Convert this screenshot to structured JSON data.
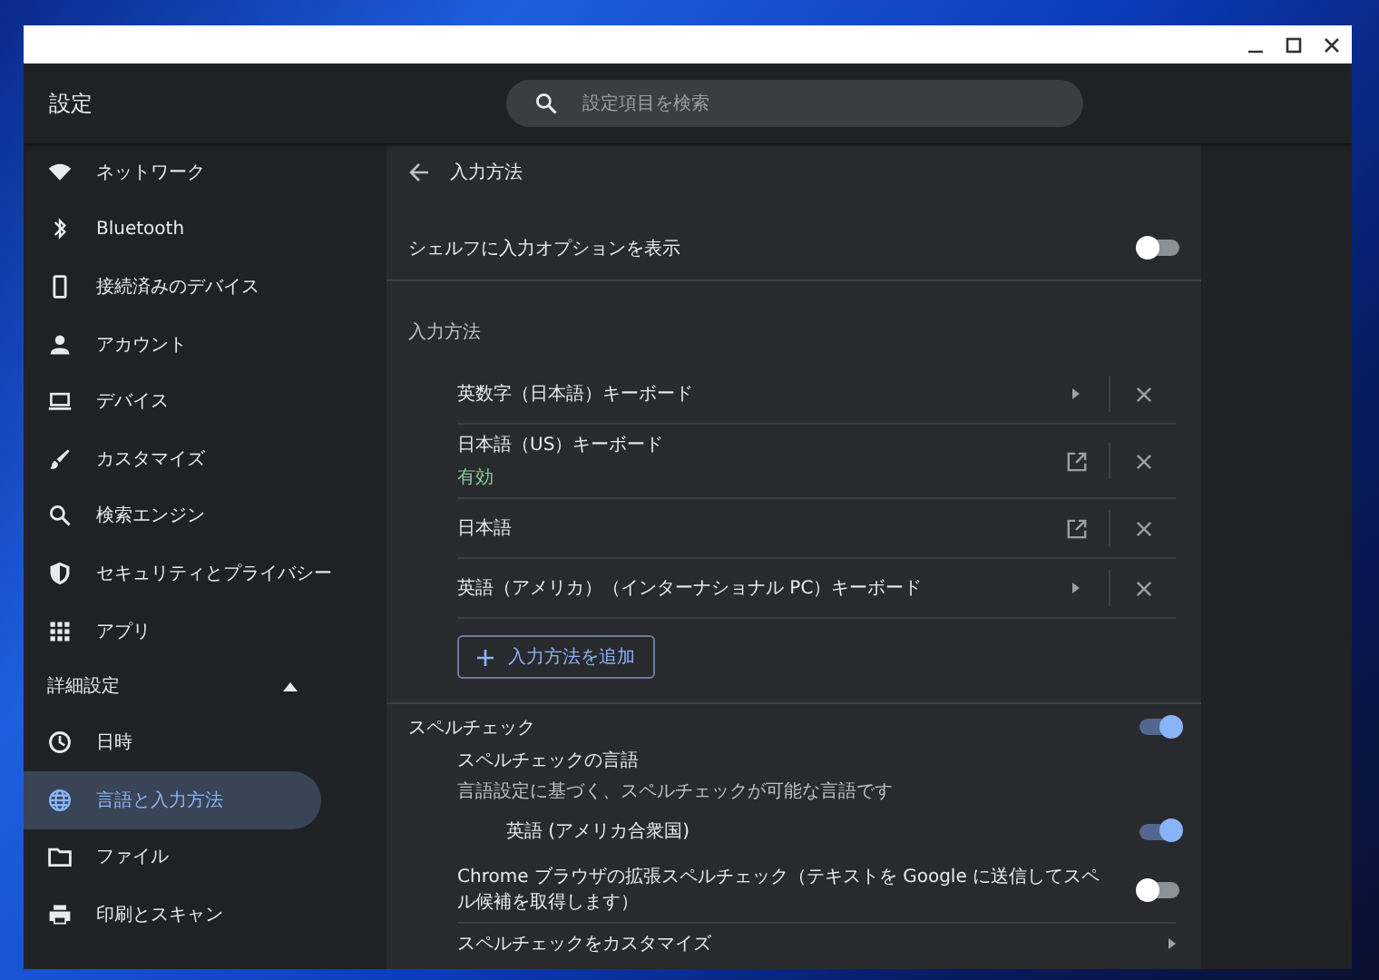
{
  "app": {
    "title": "設定",
    "search": {
      "placeholder": "設定項目を検索"
    }
  },
  "sidebar": {
    "items": [
      {
        "label": "ネットワーク",
        "selected": false
      },
      {
        "label": "Bluetooth",
        "selected": false
      },
      {
        "label": "接続済みのデバイス",
        "selected": false
      },
      {
        "label": "アカウント",
        "selected": false
      },
      {
        "label": "デバイス",
        "selected": false
      },
      {
        "label": "カスタマイズ",
        "selected": false
      },
      {
        "label": "検索エンジン",
        "selected": false
      },
      {
        "label": "セキュリティとプライバシー",
        "selected": false
      },
      {
        "label": "アプリ",
        "selected": false
      }
    ],
    "advanced": {
      "label": "詳細設定",
      "expanded": true,
      "items": [
        {
          "label": "日時",
          "selected": false
        },
        {
          "label": "言語と入力方法",
          "selected": true
        },
        {
          "label": "ファイル",
          "selected": false
        },
        {
          "label": "印刷とスキャン",
          "selected": false
        }
      ]
    }
  },
  "page": {
    "title": "入力方法",
    "shelf_option": {
      "label": "シェルフに入力オプションを表示",
      "on": false
    },
    "input_methods": {
      "heading": "入力方法",
      "items": [
        {
          "name": "英数字（日本語）キーボード",
          "kind": "submenu"
        },
        {
          "name": "日本語（US）キーボード",
          "status": "有効",
          "kind": "external"
        },
        {
          "name": "日本語",
          "kind": "external"
        },
        {
          "name": "英語（アメリカ）（インターナショナル PC）キーボード",
          "kind": "submenu"
        }
      ],
      "add_button": "入力方法を追加"
    },
    "spellcheck": {
      "label": "スペルチェック",
      "on": true,
      "languages_title": "スペルチェックの言語",
      "languages_subtitle": "言語設定に基づく、スペルチェックが可能な言語です",
      "languages": [
        {
          "name": "英語 (アメリカ合衆国)",
          "on": true
        }
      ],
      "enhanced": {
        "label": "Chrome ブラウザの拡張スペルチェック（テキストを Google に送信してスペル候補を取得します）",
        "on": false
      },
      "customize": "スペルチェックをカスタマイズ"
    }
  }
}
